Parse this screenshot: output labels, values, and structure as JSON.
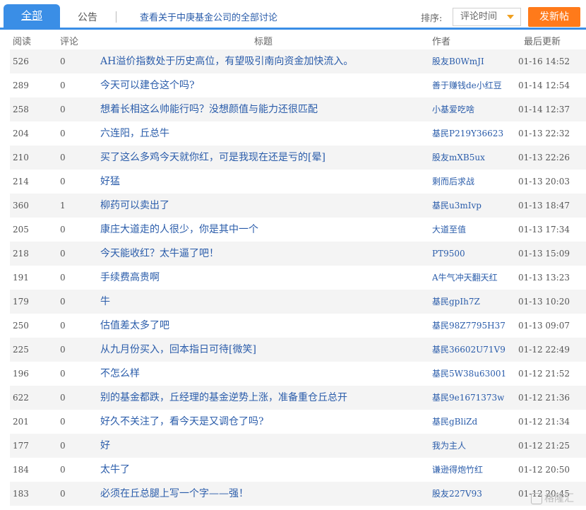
{
  "tabs": {
    "all": "全部",
    "notice": "公告",
    "link": "查看关于中庚基金公司的全部讨论"
  },
  "sort": {
    "label": "排序:",
    "selected": "评论时间"
  },
  "post_button": "发新帖",
  "columns": {
    "read": "阅读",
    "comment": "评论",
    "title": "标题",
    "author": "作者",
    "updated": "最后更新"
  },
  "rows": [
    {
      "read": "526",
      "comment": "0",
      "title": "AH溢价指数处于历史高位，有望吸引南向资金加快流入。",
      "author": "股友B0WmJI",
      "time": "01-16 14:52"
    },
    {
      "read": "289",
      "comment": "0",
      "title": "今天可以建仓这个吗?",
      "author": "善于赚钱de小红豆",
      "time": "01-14 12:54"
    },
    {
      "read": "258",
      "comment": "0",
      "title": "想着长相这么帅能行吗？没想颜值与能力还很匹配",
      "author": "小基爱吃啥",
      "time": "01-14 12:37"
    },
    {
      "read": "204",
      "comment": "0",
      "title": "六连阳，丘总牛",
      "author": "基民P219Y36623",
      "time": "01-13 22:32"
    },
    {
      "read": "210",
      "comment": "0",
      "title": "买了这么多鸡今天就你红，可是我现在还是亏的[晕]",
      "author": "股友mXB5ux",
      "time": "01-13 22:26"
    },
    {
      "read": "214",
      "comment": "0",
      "title": "好猛",
      "author": "剩而后求战",
      "time": "01-13 20:03"
    },
    {
      "read": "360",
      "comment": "1",
      "title": "柳药可以卖出了",
      "author": "基民u3mIvp",
      "time": "01-13 18:47"
    },
    {
      "read": "205",
      "comment": "0",
      "title": "康庄大道走的人很少，你是其中一个",
      "author": "大道至值",
      "time": "01-13 17:34"
    },
    {
      "read": "218",
      "comment": "0",
      "title": "今天能收红？太牛逼了吧！",
      "author": "PT9500",
      "time": "01-13 15:09"
    },
    {
      "read": "191",
      "comment": "0",
      "title": "手续费高贵啊",
      "author": "A牛气冲天翻天红",
      "time": "01-13 13:23"
    },
    {
      "read": "179",
      "comment": "0",
      "title": "牛",
      "author": "基民gpIh7Z",
      "time": "01-13 10:20"
    },
    {
      "read": "250",
      "comment": "0",
      "title": "估值差太多了吧",
      "author": "基民98Z7795H37",
      "time": "01-13 09:07"
    },
    {
      "read": "225",
      "comment": "0",
      "title": "从九月份买入，回本指日可待[微笑]",
      "author": "基民36602U71V9",
      "time": "01-12 22:49"
    },
    {
      "read": "196",
      "comment": "0",
      "title": "不怎么样",
      "author": "基民5W38u63001",
      "time": "01-12 21:52"
    },
    {
      "read": "622",
      "comment": "0",
      "title": "别的基金都跌，丘经理的基金逆势上涨，准备重仓丘总开",
      "author": "基民9e1671373w",
      "time": "01-12 21:36"
    },
    {
      "read": "201",
      "comment": "0",
      "title": "好久不关注了，看今天是又调仓了吗?",
      "author": "基民gBliZd",
      "time": "01-12 21:34"
    },
    {
      "read": "177",
      "comment": "0",
      "title": "好",
      "author": "我为主人",
      "time": "01-12 21:25"
    },
    {
      "read": "184",
      "comment": "0",
      "title": "太牛了",
      "author": "谦逊得炮竹红",
      "time": "01-12 20:50"
    },
    {
      "read": "183",
      "comment": "0",
      "title": "必须在丘总腿上写一个字——强！",
      "author": "股友227V93",
      "time": "01-12 20:45"
    }
  ],
  "watermark": "格隆汇",
  "colors": {
    "accent": "#3a8ee6",
    "post_button": "#ff7a1a",
    "link": "#2a5caa"
  }
}
